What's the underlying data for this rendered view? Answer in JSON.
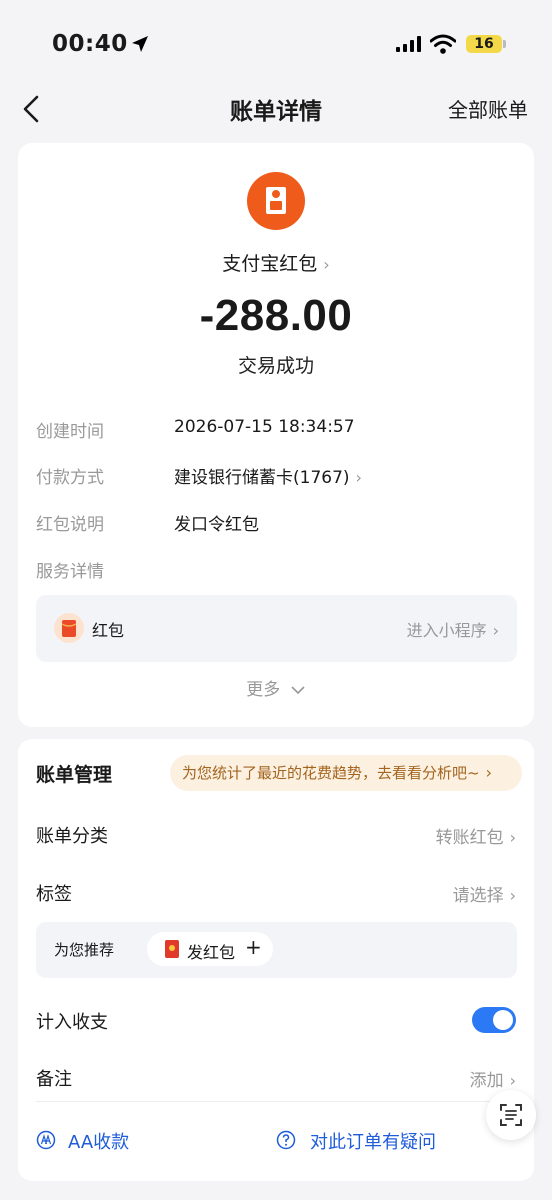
{
  "status_bar": {
    "time": "00:40",
    "battery": "16"
  },
  "nav": {
    "title": "账单详情",
    "right": "全部账单"
  },
  "bill": {
    "merchant": "支付宝红包",
    "amount": "-288.00",
    "status": "交易成功",
    "rows": [
      {
        "label": "创建时间",
        "value": "2026-07-15 18:34:57"
      },
      {
        "label": "付款方式",
        "value": "建设银行储蓄卡(1767)"
      },
      {
        "label": "红包说明",
        "value": "发口令红包"
      },
      {
        "label": "服务详情",
        "value": ""
      }
    ],
    "service": {
      "name": "红包",
      "link": "进入小程序"
    },
    "more": "更多"
  },
  "management": {
    "title": "账单管理",
    "promo": "为您统计了最近的花费趋势，去看看分析吧~",
    "category_label": "账单分类",
    "category_value": "转账红包",
    "tag_label": "标签",
    "tag_value": "请选择",
    "recommend_label": "为您推荐",
    "recommend_chip": "发红包",
    "include_label": "计入收支",
    "include_on": true,
    "note_label": "备注",
    "note_value": "添加",
    "aa_link": "AA收款",
    "question_link": "对此订单有疑问"
  },
  "colors": {
    "accent": "#2b79f5",
    "logo": "#ee5b1b",
    "link": "#1f5cd9",
    "promo_text": "#a3651e"
  },
  "icons": [
    "location-arrow-icon",
    "signal-icon",
    "wifi-icon",
    "battery-icon",
    "back-chevron-icon",
    "red-packet-icon",
    "chevron-right-icon",
    "chevron-down-icon",
    "plus-icon",
    "aa-icon",
    "question-icon",
    "scan-text-icon"
  ]
}
